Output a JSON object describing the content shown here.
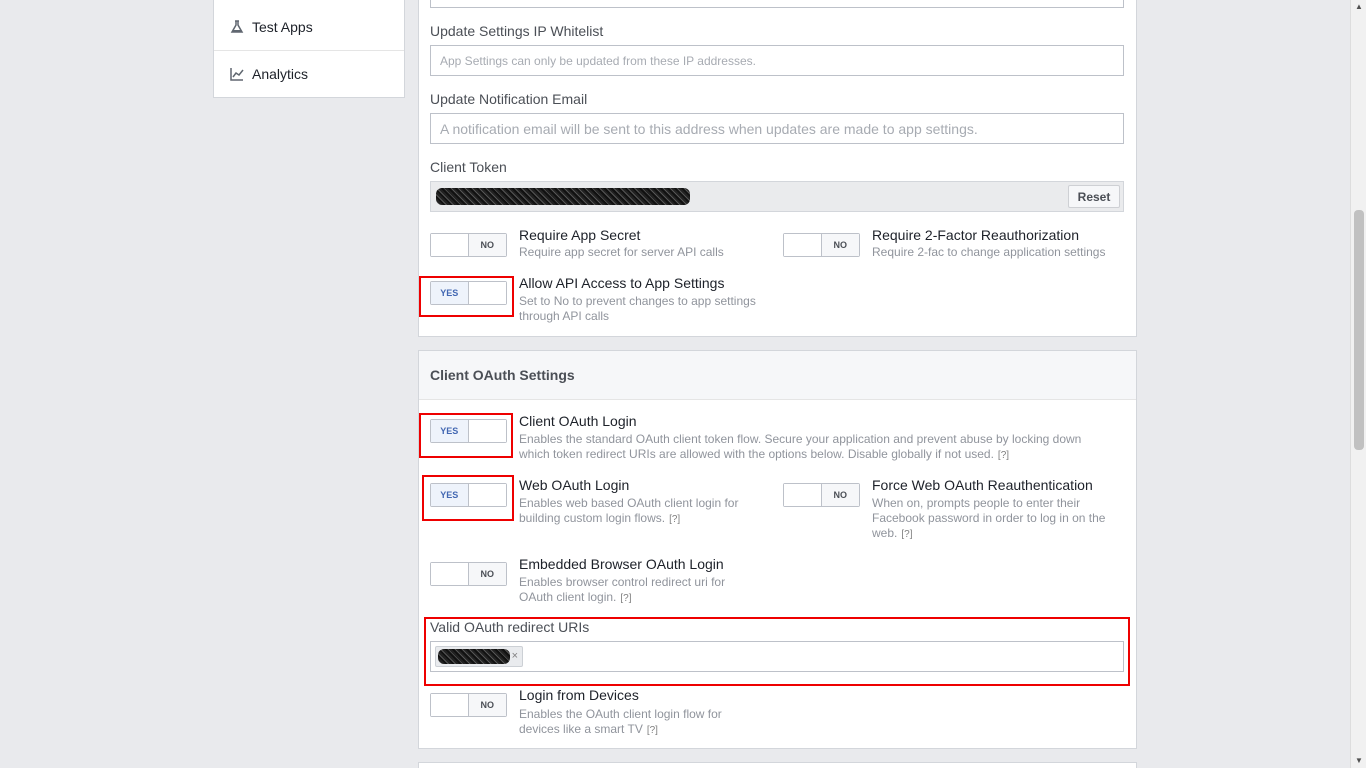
{
  "sidebar": {
    "items": [
      {
        "label": "Test Apps",
        "icon": "flask-icon"
      },
      {
        "label": "Analytics",
        "icon": "chart-icon"
      }
    ]
  },
  "advanced": {
    "ip_whitelist": {
      "label": "Update Settings IP Whitelist",
      "placeholder": "App Settings can only be updated from these IP addresses."
    },
    "notify_email": {
      "label": "Update Notification Email",
      "placeholder": "A notification email will be sent to this address when updates are made to app settings."
    },
    "client_token": {
      "label": "Client Token",
      "reset_label": "Reset"
    },
    "require_secret": {
      "toggle": "NO",
      "title": "Require App Secret",
      "desc": "Require app secret for server API calls"
    },
    "require_2fa": {
      "toggle": "NO",
      "title": "Require 2-Factor Reauthorization",
      "desc": "Require 2-fac to change application settings"
    },
    "api_access": {
      "toggle": "YES",
      "title": "Allow API Access to App Settings",
      "desc1": "Set to No to prevent changes to app settings",
      "desc2": "through API calls"
    }
  },
  "oauth": {
    "heading": "Client OAuth Settings",
    "client_login": {
      "toggle": "YES",
      "title": "Client OAuth Login",
      "desc1": "Enables the standard OAuth client token flow. Secure your application and prevent abuse by locking down",
      "desc2": "which token redirect URIs are allowed with the options below. Disable globally if not used.",
      "help": "[?]"
    },
    "web_login": {
      "toggle": "YES",
      "title": "Web OAuth Login",
      "desc1": "Enables web based OAuth client login for",
      "desc2": "building custom login flows.",
      "help": "[?]"
    },
    "force_reauth": {
      "toggle": "NO",
      "title": "Force Web OAuth Reauthentication",
      "desc1": "When on, prompts people to enter their",
      "desc2": "Facebook password in order to log in on the",
      "desc3": "web.",
      "help": "[?]"
    },
    "embedded": {
      "toggle": "NO",
      "title": "Embedded Browser OAuth Login",
      "desc1": "Enables browser control redirect uri for",
      "desc2": "OAuth client login.",
      "help": "[?]"
    },
    "redirect_uris": {
      "label": "Valid OAuth redirect URIs",
      "chip_remove": "×"
    },
    "devices": {
      "toggle": "NO",
      "title": "Login from Devices",
      "desc1": "Enables the OAuth client login flow for",
      "desc2": "devices like a smart TV",
      "help": "[?]"
    }
  },
  "colors": {
    "highlight": "#ee0000",
    "yes_blue": "#4267b2"
  }
}
